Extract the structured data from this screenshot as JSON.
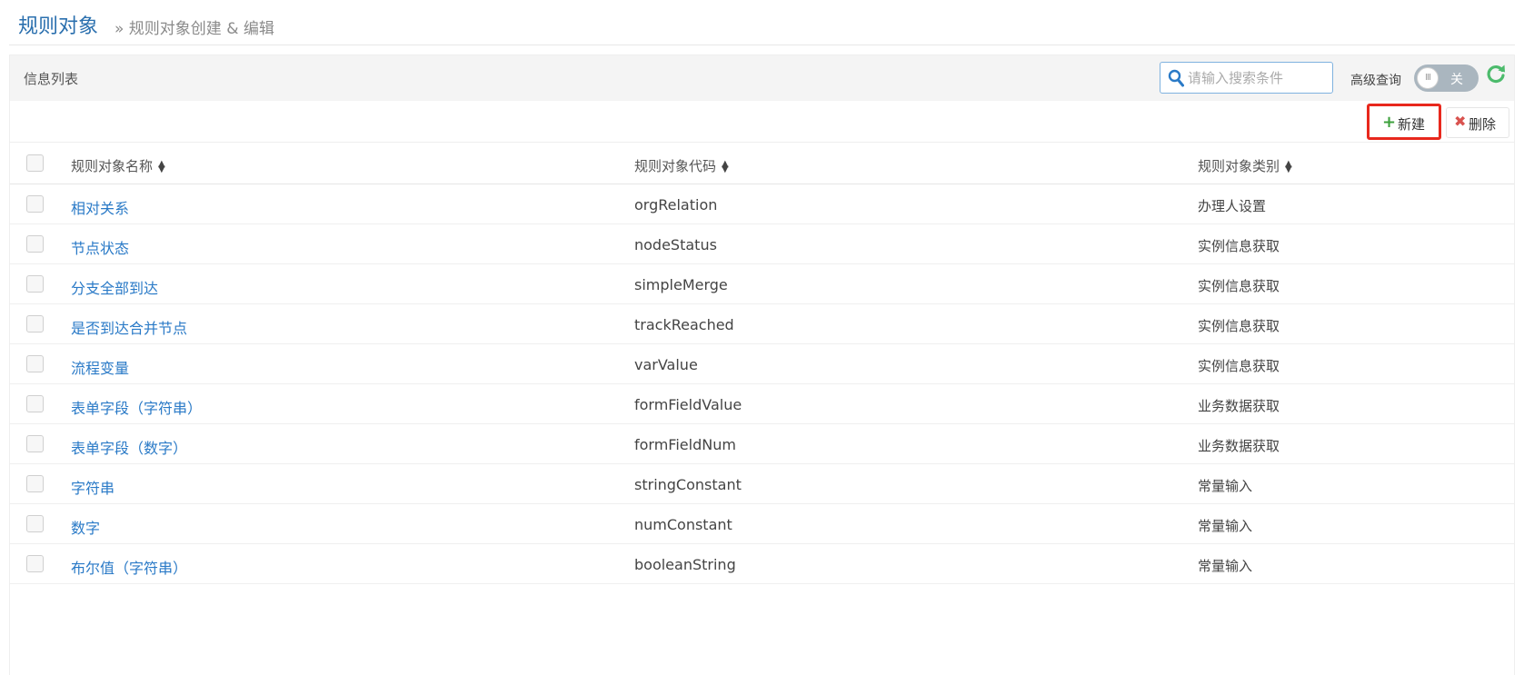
{
  "header": {
    "title": "规则对象",
    "subtitle": "» 规则对象创建 & 编辑"
  },
  "panel": {
    "title": "信息列表",
    "search": {
      "placeholder": "请输入搜索条件",
      "value": ""
    },
    "advanced_label": "高级查询",
    "toggle": {
      "knob_text": "III",
      "state_text": "关",
      "on": false
    },
    "icons": {
      "search": "search-icon",
      "refresh": "refresh-icon"
    }
  },
  "toolbar": {
    "new_label": "新建",
    "delete_label": "删除"
  },
  "table": {
    "columns": [
      "规则对象名称",
      "规则对象代码",
      "规则对象类别"
    ],
    "rows": [
      {
        "name": "相对关系",
        "code": "orgRelation",
        "category": "办理人设置"
      },
      {
        "name": "节点状态",
        "code": "nodeStatus",
        "category": "实例信息获取"
      },
      {
        "name": "分支全部到达",
        "code": "simpleMerge",
        "category": "实例信息获取"
      },
      {
        "name": "是否到达合并节点",
        "code": "trackReached",
        "category": "实例信息获取"
      },
      {
        "name": "流程变量",
        "code": "varValue",
        "category": "实例信息获取"
      },
      {
        "name": "表单字段（字符串）",
        "code": "formFieldValue",
        "category": "业务数据获取"
      },
      {
        "name": "表单字段（数字）",
        "code": "formFieldNum",
        "category": "业务数据获取"
      },
      {
        "name": "字符串",
        "code": "stringConstant",
        "category": "常量输入"
      },
      {
        "name": "数字",
        "code": "numConstant",
        "category": "常量输入"
      },
      {
        "name": "布尔值（字符串）",
        "code": "booleanString",
        "category": "常量输入"
      }
    ]
  },
  "colors": {
    "title": "#2a6fae",
    "link": "#2a7ac7",
    "highlight_border": "#e8281d",
    "plus_icon": "#3da13d",
    "delete_icon": "#d9534f",
    "refresh_icon": "#4cbb6c"
  }
}
